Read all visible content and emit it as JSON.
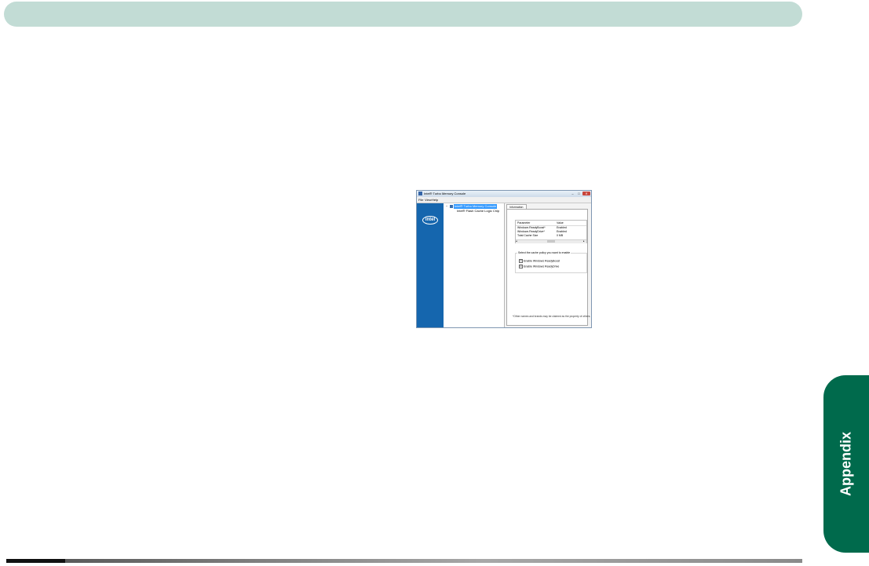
{
  "page": {
    "side_tab_label": "Appendix",
    "colors": {
      "top_bar": "#c2dcd5",
      "side_tab": "#006a4c",
      "intel_blue": "#1566ae"
    }
  },
  "app": {
    "title": "Intel® Turbo Memory Console",
    "window_controls": {
      "minimize": "–",
      "maximize": "□",
      "close": "✕"
    },
    "menu": {
      "file": "File",
      "view": "View",
      "help": "Help"
    },
    "logo_text": "intel",
    "tree": {
      "toggle": "−",
      "root": "Intel® Turbo Memory Console",
      "child": "Intel® Flash Cache Logic Chip"
    },
    "tab": "Information",
    "table": {
      "headers": {
        "parameter": "Parameter",
        "value": "Value"
      },
      "rows": [
        {
          "parameter": "Windows ReadyBoost*",
          "value": "Enabled"
        },
        {
          "parameter": "Windows ReadyDrive*",
          "value": "Enabled"
        },
        {
          "parameter": "Total Cache Size",
          "value": "0 MB"
        }
      ]
    },
    "policy": {
      "caption": "Select the cache policy you want to enable",
      "options": [
        {
          "label": "Enable Windows ReadyBoost",
          "checked": "☑"
        },
        {
          "label": "Enable Windows ReadyDrive",
          "checked": "☑"
        }
      ]
    },
    "footnote": "*Other names and brands may be claimed as the property of others."
  }
}
